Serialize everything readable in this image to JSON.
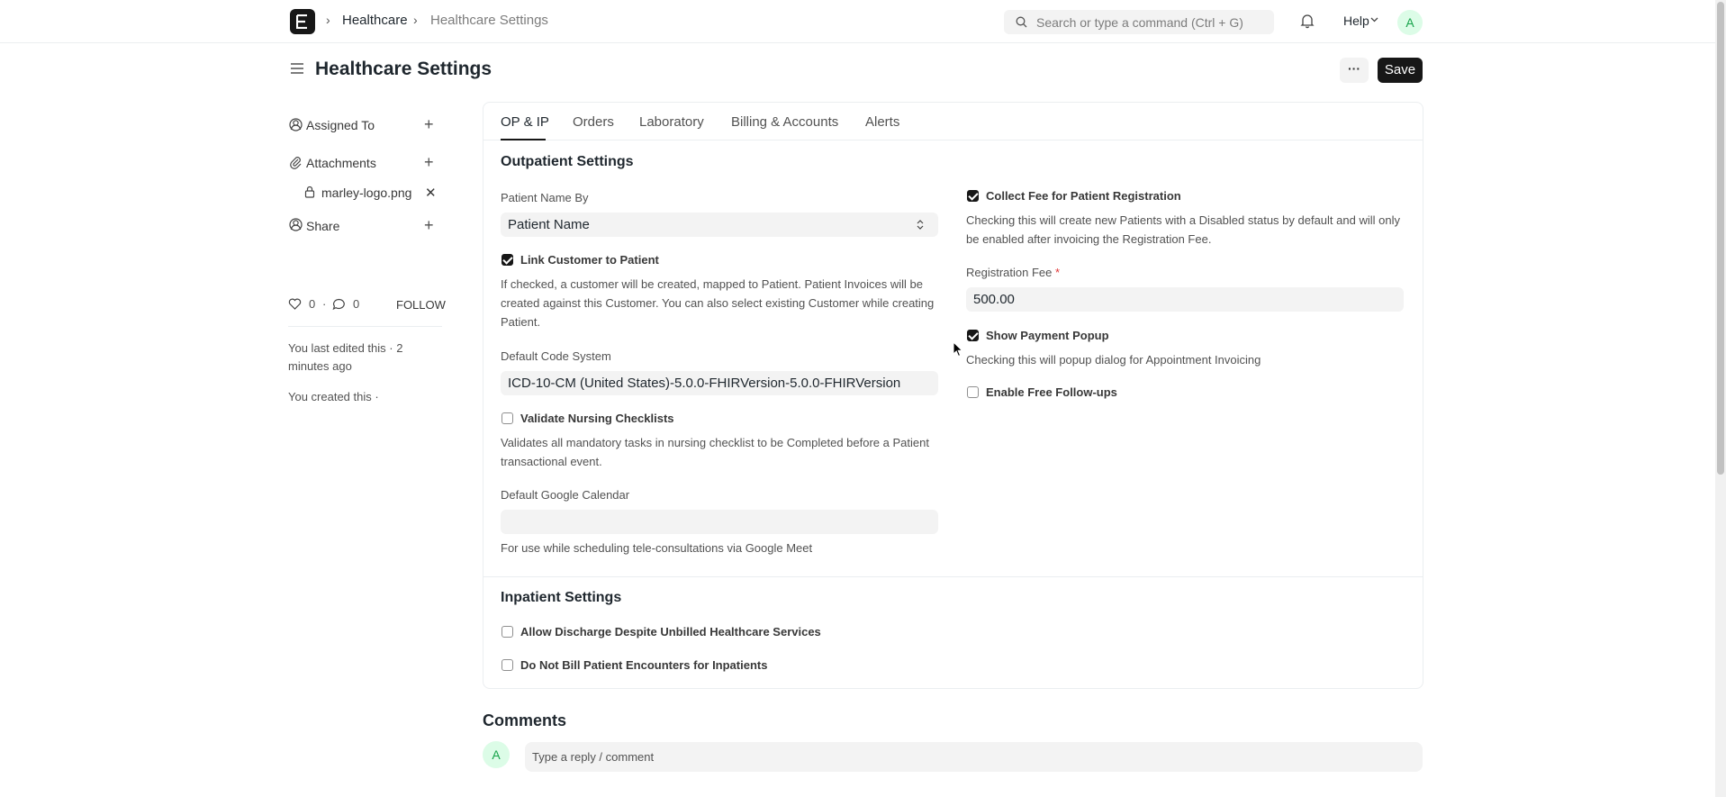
{
  "navbar": {
    "breadcrumbs": [
      "Healthcare",
      "Healthcare Settings"
    ],
    "search_placeholder": "Search or type a command (Ctrl + G)",
    "help_label": "Help",
    "avatar_initial": "A"
  },
  "page": {
    "title": "Healthcare Settings",
    "more_label": "···",
    "save_label": "Save"
  },
  "sidebar": {
    "assigned_to": "Assigned To",
    "attachments": "Attachments",
    "attachment_file": "marley-logo.png",
    "share": "Share",
    "likes": "0",
    "comments_count": "0",
    "follow": "FOLLOW",
    "last_edited": "You last edited this · 2 minutes ago",
    "created": "You created this ·"
  },
  "tabs": [
    "OP & IP",
    "Orders",
    "Laboratory",
    "Billing & Accounts",
    "Alerts"
  ],
  "outpatient": {
    "title": "Outpatient Settings",
    "patient_name_by_label": "Patient Name By",
    "patient_name_by_value": "Patient Name",
    "link_customer_label": "Link Customer to Patient",
    "link_customer_checked": true,
    "link_customer_desc": "If checked, a customer will be created, mapped to Patient. Patient Invoices will be created against this Customer. You can also select existing Customer while creating Patient.",
    "code_system_label": "Default Code System",
    "code_system_value": "ICD-10-CM (United States)-5.0.0-FHIRVersion-5.0.0-FHIRVersion",
    "validate_nursing_label": "Validate Nursing Checklists",
    "validate_nursing_checked": false,
    "validate_nursing_desc": "Validates all mandatory tasks in nursing checklist to be Completed before a Patient transactional event.",
    "google_calendar_label": "Default Google Calendar",
    "google_calendar_value": "",
    "google_calendar_desc": "For use while scheduling tele-consultations via Google Meet",
    "collect_fee_label": "Collect Fee for Patient Registration",
    "collect_fee_checked": true,
    "collect_fee_desc": "Checking this will create new Patients with a Disabled status by default and will only be enabled after invoicing the Registration Fee.",
    "registration_fee_label": "Registration Fee",
    "registration_fee_required": "*",
    "registration_fee_value": "500.00",
    "payment_popup_label": "Show Payment Popup",
    "payment_popup_checked": true,
    "payment_popup_desc": "Checking this will popup dialog for Appointment Invoicing",
    "free_followups_label": "Enable Free Follow-ups",
    "free_followups_checked": false
  },
  "inpatient": {
    "title": "Inpatient Settings",
    "allow_discharge_label": "Allow Discharge Despite Unbilled Healthcare Services",
    "allow_discharge_checked": false,
    "do_not_bill_label": "Do Not Bill Patient Encounters for Inpatients",
    "do_not_bill_checked": false
  },
  "comments": {
    "title": "Comments",
    "avatar_initial": "A",
    "placeholder": "Type a reply / comment"
  }
}
